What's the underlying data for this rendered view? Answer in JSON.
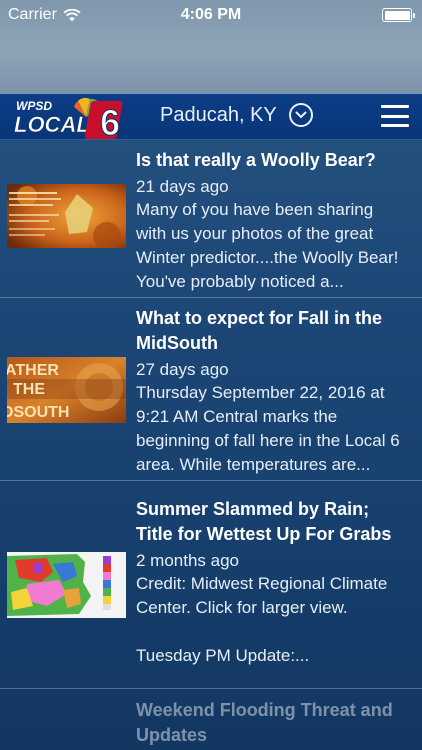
{
  "status_bar": {
    "carrier": "Carrier",
    "time": "4:06 PM"
  },
  "header": {
    "logo_text_top": "WPSD",
    "logo_text_main": "LOCAL",
    "logo_number": "6",
    "location": "Paducah, KY"
  },
  "colors": {
    "header_blue": "#0b3d86",
    "logo_red": "#c8102e",
    "background": "#1c4776"
  },
  "articles": [
    {
      "title": "Is that really a Woolly Bear?",
      "age": "21 days ago",
      "excerpt": "Many of you have been sharing with us your photos of the great Winter predictor....the Woolly Bear! You've probably noticed a..."
    },
    {
      "title": "What to expect for Fall in the MidSouth",
      "age": "27 days ago",
      "excerpt": "Thursday September 22, 2016 at 9:21 AM Central marks the beginning of fall here in the Local 6 area. While temperatures are..."
    },
    {
      "title": "Summer Slammed by Rain; Title for Wettest Up For Grabs",
      "age": "2 months ago",
      "excerpt": "Credit: Midwest Regional Climate Center. Click for larger view.\n\nTuesday PM Update:..."
    },
    {
      "title": "Weekend Flooding Threat and Updates"
    }
  ],
  "thumbnails": {
    "fall_text_1": "ATHER",
    "fall_text_2": "THE",
    "fall_text_3": "OSOUTH"
  }
}
